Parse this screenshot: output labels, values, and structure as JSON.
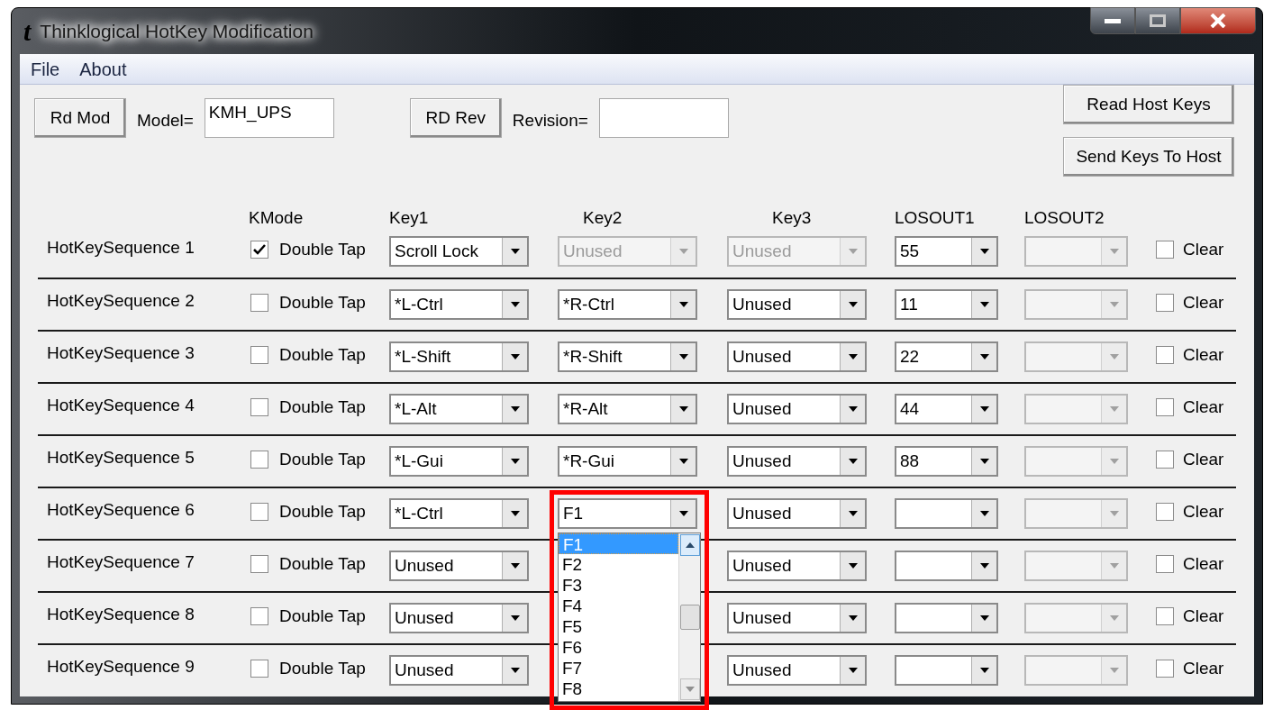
{
  "window": {
    "logo": "t",
    "title": "Thinklogical HotKey Modification"
  },
  "menu": [
    "File",
    "About"
  ],
  "toolbar": {
    "rd_mod_button": "Rd Mod",
    "model_label": "Model=",
    "model_value": "KMH_UPS",
    "rd_rev_button": "RD Rev",
    "revision_label": "Revision=",
    "read_host_keys_button": "Read Host Keys",
    "send_keys_button": "Send Keys To Host"
  },
  "columns": [
    "KMode",
    "Key1",
    "Key2",
    "Key3",
    "LOSOUT1",
    "LOSOUT2"
  ],
  "rows": [
    {
      "label": "HotKeySequence 1",
      "double_tap": {
        "label": "Double Tap",
        "checked": true
      },
      "key1": {
        "value": "Scroll Lock",
        "disabled": false
      },
      "key2": {
        "value": "Unused",
        "disabled": true
      },
      "key3": {
        "value": "Unused",
        "disabled": true
      },
      "losout1": {
        "value": "55",
        "disabled": false
      },
      "losout2": {
        "disabled": true
      },
      "clear": {
        "label": "Clear",
        "checked": false
      }
    },
    {
      "label": "HotKeySequence 2",
      "double_tap": {
        "label": "Double Tap",
        "checked": false
      },
      "key1": {
        "value": "*L-Ctrl",
        "disabled": false
      },
      "key2": {
        "value": "*R-Ctrl",
        "disabled": false
      },
      "key3": {
        "value": "Unused",
        "disabled": false
      },
      "losout1": {
        "value": "11",
        "disabled": false
      },
      "losout2": {
        "disabled": true
      },
      "clear": {
        "label": "Clear",
        "checked": false
      }
    },
    {
      "label": "HotKeySequence 3",
      "double_tap": {
        "label": "Double Tap",
        "checked": false
      },
      "key1": {
        "value": "*L-Shift",
        "disabled": false
      },
      "key2": {
        "value": "*R-Shift",
        "disabled": false
      },
      "key3": {
        "value": "Unused",
        "disabled": false
      },
      "losout1": {
        "value": "22",
        "disabled": false
      },
      "losout2": {
        "disabled": true
      },
      "clear": {
        "label": "Clear",
        "checked": false
      }
    },
    {
      "label": "HotKeySequence 4",
      "double_tap": {
        "label": "Double Tap",
        "checked": false
      },
      "key1": {
        "value": "*L-Alt",
        "disabled": false
      },
      "key2": {
        "value": "*R-Alt",
        "disabled": false
      },
      "key3": {
        "value": "Unused",
        "disabled": false
      },
      "losout1": {
        "value": "44",
        "disabled": false
      },
      "losout2": {
        "disabled": true
      },
      "clear": {
        "label": "Clear",
        "checked": false
      }
    },
    {
      "label": "HotKeySequence 5",
      "double_tap": {
        "label": "Double Tap",
        "checked": false
      },
      "key1": {
        "value": "*L-Gui",
        "disabled": false
      },
      "key2": {
        "value": "*R-Gui",
        "disabled": false
      },
      "key3": {
        "value": "Unused",
        "disabled": false
      },
      "losout1": {
        "value": "88",
        "disabled": false
      },
      "losout2": {
        "disabled": true
      },
      "clear": {
        "label": "Clear",
        "checked": false
      }
    },
    {
      "label": "HotKeySequence 6",
      "double_tap": {
        "label": "Double Tap",
        "checked": false
      },
      "key1": {
        "value": "*L-Ctrl",
        "disabled": false
      },
      "key2": {
        "value": "F1",
        "disabled": false,
        "open": true,
        "highlighted": true,
        "options": [
          {
            "label": "F1",
            "selected": true
          },
          {
            "label": "F2",
            "selected": false
          },
          {
            "label": "F3",
            "selected": false
          },
          {
            "label": "F4",
            "selected": false
          },
          {
            "label": "F5",
            "selected": false
          },
          {
            "label": "F6",
            "selected": false
          },
          {
            "label": "F7",
            "selected": false
          },
          {
            "label": "F8",
            "selected": false
          }
        ]
      },
      "key3": {
        "value": "Unused",
        "disabled": false
      },
      "losout1": {
        "disabled": false
      },
      "losout2": {
        "disabled": true
      },
      "clear": {
        "label": "Clear",
        "checked": false
      }
    },
    {
      "label": "HotKeySequence 7",
      "double_tap": {
        "label": "Double Tap",
        "checked": false
      },
      "key1": {
        "value": "Unused",
        "disabled": false
      },
      "key3": {
        "value": "Unused",
        "disabled": false
      },
      "losout1": {
        "disabled": false
      },
      "losout2": {
        "disabled": true
      },
      "clear": {
        "label": "Clear",
        "checked": false
      }
    },
    {
      "label": "HotKeySequence 8",
      "double_tap": {
        "label": "Double Tap",
        "checked": false
      },
      "key1": {
        "value": "Unused",
        "disabled": false
      },
      "key3": {
        "value": "Unused",
        "disabled": false
      },
      "losout1": {
        "disabled": false
      },
      "losout2": {
        "disabled": true
      },
      "clear": {
        "label": "Clear",
        "checked": false
      }
    },
    {
      "label": "HotKeySequence 9",
      "double_tap": {
        "label": "Double Tap",
        "checked": false
      },
      "key1": {
        "value": "Unused",
        "disabled": false
      },
      "key3": {
        "value": "Unused",
        "disabled": false
      },
      "losout1": {
        "disabled": false
      },
      "losout2": {
        "disabled": true
      },
      "clear": {
        "label": "Clear",
        "checked": false
      }
    }
  ]
}
